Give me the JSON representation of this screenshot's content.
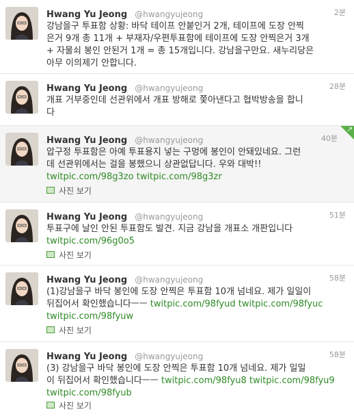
{
  "tweets": [
    {
      "name": "Hwang Yu Jeong",
      "handle": "@hwangyujeong",
      "time": "2분",
      "lines": [
        "강남을구 투표함 상황: 바닥 테이프 안붙인거 2개, 테이프에 도장 안찍",
        "은거 9개 총 11개 + 부재자/우편투표함에 테이프에 도장 안찍은거 3개",
        "+ 자물쇠 봉인 안된거 1개 = 총 15개입니다. 강남을구만요. 새누리당은",
        "아무 이의제기 안합니다."
      ]
    },
    {
      "name": "Hwang Yu Jeong",
      "handle": "@hwangyujeong",
      "time": "28분",
      "lines": [
        "개표 거부중인데 선관위에서 개표 방해로 쫓아낸다고 협박방송을 합니",
        "다"
      ]
    },
    {
      "name": "Hwang Yu Jeong",
      "handle": "@hwangyujeong",
      "time": "40분",
      "lines": [
        "압구정 투표함은 아예 투표용지 넣는 구멍에 봉인이 안돼있네요. 그런",
        "데 선관위에서는 걸을 봉했으니 상관없답니다. 우와 대박!!"
      ],
      "links": [
        "twitpic.com/98g3zo",
        "twitpic.com/98g3zr"
      ],
      "media_label": "사진 보기"
    },
    {
      "name": "Hwang Yu Jeong",
      "handle": "@hwangyujeong",
      "time": "51분",
      "lines": [
        "투표구에 날인 안된 투표함도 발견. 지금 강남을 개표소 개판입니다"
      ],
      "links": [
        "twitpic.com/96g0o5"
      ],
      "media_label": "사진 보기"
    },
    {
      "name": "Hwang Yu Jeong",
      "handle": "@hwangyujeong",
      "time": "58분",
      "lines": [
        "(1)강남을구 바닥 봉인에 도장 안찍은 투표함 10개 넘네요. 제가 일일이",
        "뒤집어서 확인했습니다ㅡㅡ"
      ],
      "inline_links": [
        "twitpic.com/98fyud",
        "twitpic.com/98fyuc"
      ],
      "links": [
        "twitpic.com/98fyuw"
      ],
      "media_label": "사진 보기"
    },
    {
      "name": "Hwang Yu Jeong",
      "handle": "@hwangyujeong",
      "time": "58분",
      "lines": [
        "(3) 강남을구 바닥 봉인에 도장 안찍은 투표함 10개 넘네요. 제가 일일",
        "이 뒤집어서 확인했습니다ㅡㅡ"
      ],
      "inline_links": [
        "twitpic.com/98fyu8",
        "twitpic.com/98fyu9"
      ],
      "links": [
        "twitpic.com/98fyub"
      ],
      "media_label": "사진 보기"
    }
  ],
  "icons": {
    "avatar": "profile-photo",
    "media": "photo-icon",
    "corner": "retweet-corner-icon"
  },
  "colors": {
    "link": "#2f8a26",
    "meta": "#999999",
    "corner": "#5bb04a"
  }
}
